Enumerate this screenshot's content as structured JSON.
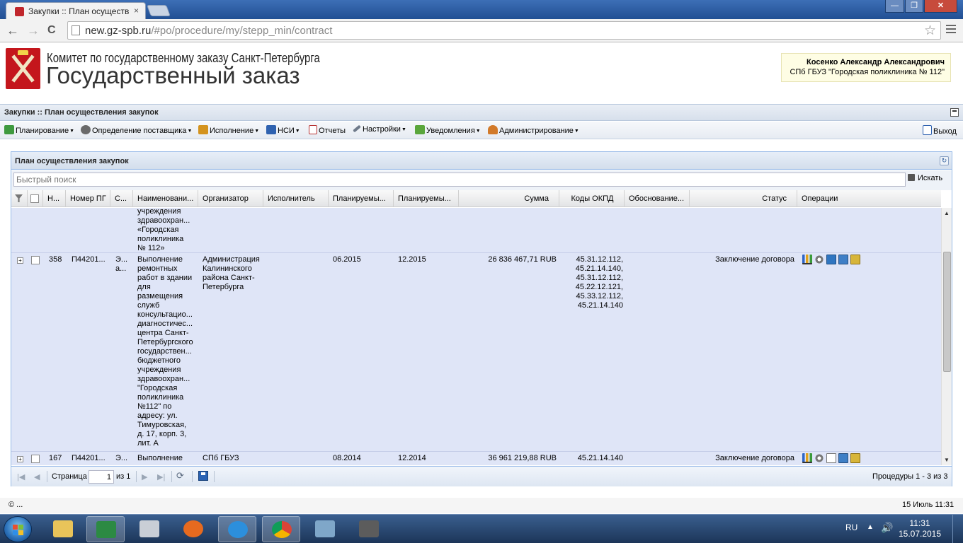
{
  "browser": {
    "tab_title": "Закупки :: План осуществ",
    "tab_close": "×",
    "url_host": "new.gz-spb.ru",
    "url_path": "/#po/procedure/my/stepp_min/contract",
    "win_min": "—",
    "win_max": "❐",
    "win_close": "✕",
    "back": "←",
    "forward": "→",
    "reload": "C",
    "star": "☆"
  },
  "header": {
    "subtitle": "Комитет по государственному заказу Санкт-Петербурга",
    "title": "Государственный заказ",
    "user_name": "Косенко Александр Александрович",
    "user_org": "СПб ГБУЗ \"Городская поликлиника № 112\""
  },
  "panel": {
    "title": "Закупки :: План осуществления закупок"
  },
  "menu": {
    "items": [
      {
        "label": "Планирование",
        "icon": "planning-icon",
        "color": "#3f9a3f"
      },
      {
        "label": "Определение поставщика",
        "icon": "gears-icon",
        "color": "#6a6a6a"
      },
      {
        "label": "Исполнение",
        "icon": "execution-icon",
        "color": "#d4931e"
      },
      {
        "label": "НСИ",
        "icon": "book-icon",
        "color": "#2f62b0"
      },
      {
        "label": "Отчеты",
        "icon": "report-icon",
        "color": "#b73333"
      },
      {
        "label": "Настройки",
        "icon": "wrench-icon",
        "color": "#6f7a8a"
      },
      {
        "label": "Уведомления",
        "icon": "notifications-icon",
        "color": "#5aa63c"
      },
      {
        "label": "Администрирование",
        "icon": "user-icon",
        "color": "#d27a2a"
      }
    ],
    "exit_label": "Выход",
    "arrow": "▼"
  },
  "grid": {
    "title": "План осуществления закупок",
    "search_placeholder": "Быстрый поиск",
    "search_button": "Искать",
    "columns": {
      "num": "Н...",
      "pg": "Номер ПГ",
      "s": "С...",
      "name": "Наименовани...",
      "organizer": "Организатор",
      "executor": "Исполнитель",
      "plan1": "Планируемы...",
      "plan2": "Планируемы...",
      "sum": "Сумма",
      "okpd": "Коды ОКПД",
      "basis": "Обоснование...",
      "status": "Статус",
      "ops": "Операции"
    },
    "rows": [
      {
        "name": "учреждения здравоохран... «Городская поликлиника № 112»"
      },
      {
        "expander": "+",
        "num": "358",
        "pg": "П44201...",
        "s": "Э... а...",
        "name": "Выполнение ремонтных работ в здании для размещения служб консультацио... диагностичес... центра Санкт-Петербургского государствен... бюджетного учреждения здравоохран... \"Городская поликлиника №112\" по адресу: ул. Тимуровская, д. 17, корп. 3, лит. А",
        "organizer": "Администрация Калининского района Санкт-Петербурга",
        "plan1": "06.2015",
        "plan2": "12.2015",
        "sum": "26 836 467,71 RUB",
        "okpd": "45.31.12.112, 45.21.14.140, 45.31.12.112, 45.22.12.121, 45.33.12.112, 45.21.14.140",
        "status": "Заключение договора"
      },
      {
        "expander": "+",
        "num": "167",
        "pg": "П44201...",
        "s": "Э...",
        "name": "Выполнение",
        "organizer": "СПб ГБУЗ",
        "plan1": "08.2014",
        "plan2": "12.2014",
        "sum": "36 961 219,88 RUB",
        "okpd": "45.21.14.140",
        "status": "Заключение договора"
      }
    ],
    "pager": {
      "page_label": "Страница",
      "page_value": "1",
      "of_label": "из 1",
      "summary": "Процедуры 1 - 3 из 3"
    }
  },
  "footer": {
    "copyright": "© ...",
    "datetime": "15 Июль 11:31"
  },
  "taskbar": {
    "lang": "RU",
    "time": "11:31",
    "date": "15.07.2015"
  }
}
